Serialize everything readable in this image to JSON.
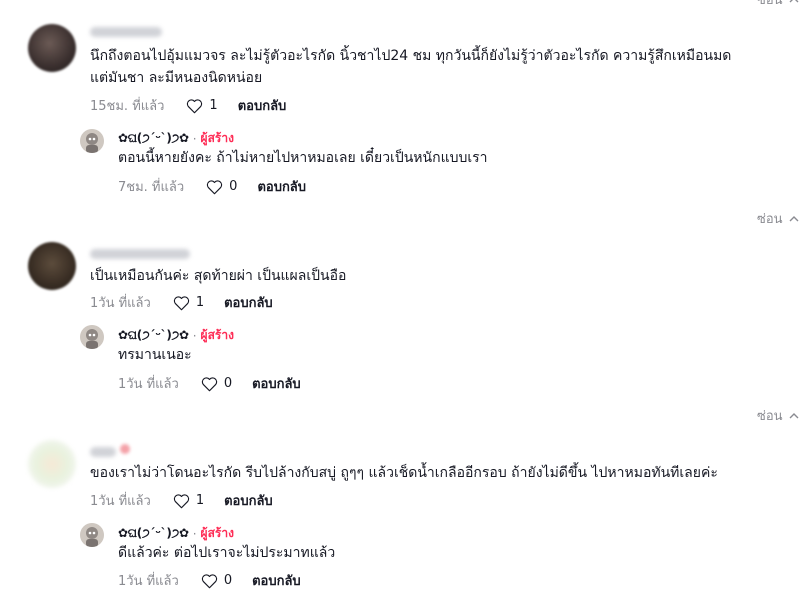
{
  "hide_label": "ซ่อน",
  "comments": [
    {
      "text_lines": [
        "นึกถึงตอนไปอุ้มแมวจร ละไม่รู้ตัวอะไรกัด นิ้วชาไป24 ชม ทุกวันนี้ก็ยังไม่รู้ว่าตัวอะไรกัด ความรู้สึกเหมือนมด",
        "แต่มันชา ละมีหนองนิดหน่อย"
      ],
      "time": "15ชม. ที่แล้ว",
      "likes": "1",
      "reply_label": "ตอบกลับ",
      "reply": {
        "author": "✿ଘ(੭ˊᵕˋ)੭✿",
        "creator_label": "ผู้สร้าง",
        "text": "ตอนนี้หายยังคะ ถ้าไม่หายไปหาหมอเลย เดี๋ยวเป็นหนักแบบเรา",
        "time": "7ชม. ที่แล้ว",
        "likes": "0",
        "reply_label": "ตอบกลับ"
      }
    },
    {
      "text_lines": [
        "เป็นเหมือนกันค่ะ สุดท้ายผ่า เป็นแผลเป็นอือ"
      ],
      "time": "1วัน ที่แล้ว",
      "likes": "1",
      "reply_label": "ตอบกลับ",
      "reply": {
        "author": "✿ଘ(੭ˊᵕˋ)੭✿",
        "creator_label": "ผู้สร้าง",
        "text": "ทรมานเนอะ",
        "time": "1วัน ที่แล้ว",
        "likes": "0",
        "reply_label": "ตอบกลับ"
      }
    },
    {
      "text_lines": [
        "ของเราไม่ว่าโดนอะไรกัด รีบไปล้างกับสบู่ ถูๆๆ แล้วเช็ดน้ำเกลืออีกรอบ ถ้ายังไม่ดีขึ้น ไปหาหมอทันทีเลยค่ะ"
      ],
      "time": "1วัน ที่แล้ว",
      "likes": "1",
      "reply_label": "ตอบกลับ",
      "reply": {
        "author": "✿ଘ(੭ˊᵕˋ)੭✿",
        "creator_label": "ผู้สร้าง",
        "text": "ดีแล้วค่ะ ต่อไปเราจะไม่ประมาทแล้ว",
        "time": "1วัน ที่แล้ว",
        "likes": "0",
        "reply_label": "ตอบกลับ"
      }
    }
  ]
}
